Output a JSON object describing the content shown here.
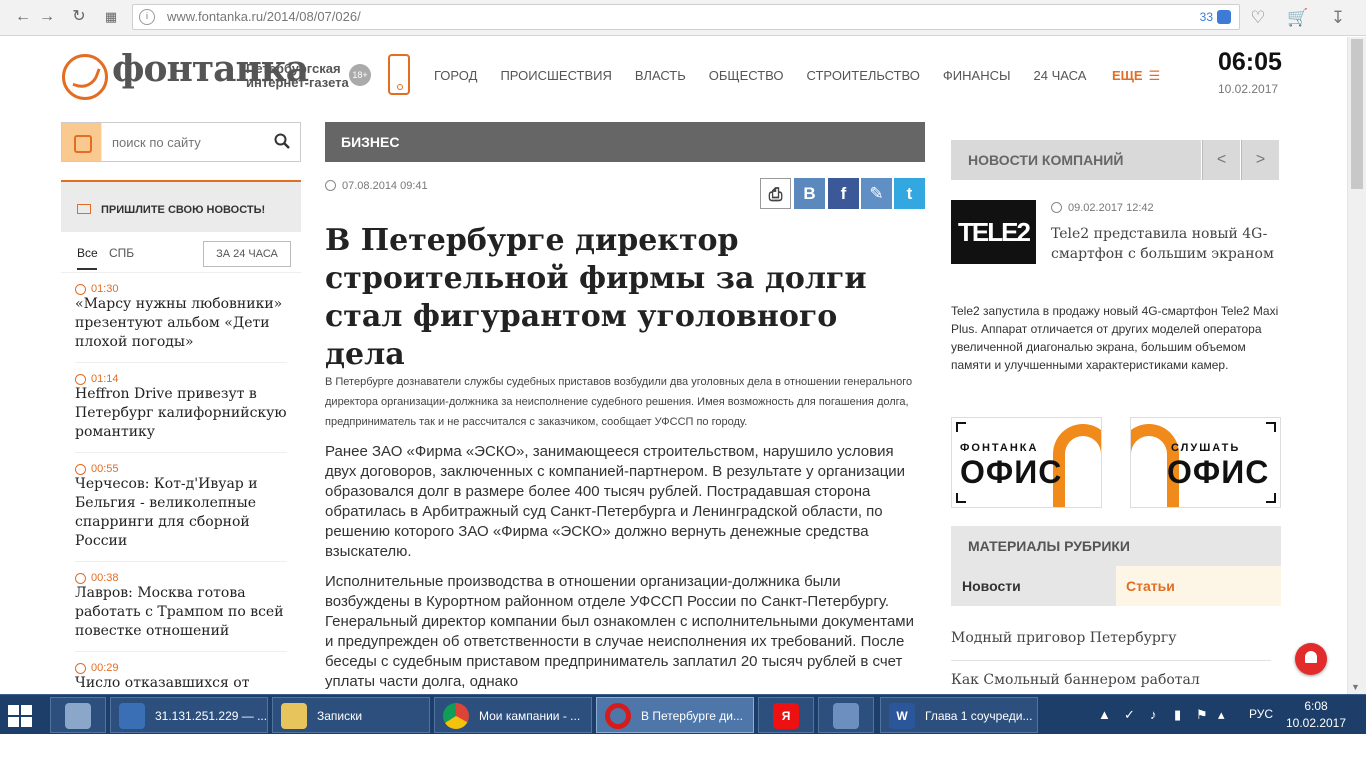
{
  "browser": {
    "url": "www.fontanka.ru/2014/08/07/026/",
    "badge_count": "33"
  },
  "site": {
    "logo": "фонтанка",
    "tagline_1": "Петербургская",
    "tagline_2": "интернет-газета",
    "age": "18+",
    "nav": [
      "ГОРОД",
      "ПРОИСШЕСТВИЯ",
      "ВЛАСТЬ",
      "ОБЩЕСТВО",
      "СТРОИТЕЛЬСТВО",
      "ФИНАНСЫ",
      "24 ЧАСА"
    ],
    "more": "ЕЩЕ",
    "time": "06:05",
    "date": "10.02.2017",
    "accent_color": "#e26d23"
  },
  "left": {
    "search_placeholder": "поиск по сайту",
    "send_news": "ПРИШЛИТЕ СВОЮ НОВОСТЬ!",
    "tab_all": "Все",
    "tab_spb": "СПБ",
    "tab_24": "ЗА 24 ЧАСА",
    "feed": [
      {
        "time": "01:30",
        "title": "«Марсу нужны любовники» презентуют альбом «Дети плохой погоды»"
      },
      {
        "time": "01:14",
        "title": "Heffron Drive привезут в Петербург калифорнийскую романтику"
      },
      {
        "time": "00:55",
        "title": "Черчесов: Кот-д'Ивуар и Бельгия - великолепные спарринги для сборной России"
      },
      {
        "time": "00:38",
        "title": "Лавров: Москва готова работать с Трампом по всей повестке отношений"
      },
      {
        "time": "00:29",
        "title": "Число отказавшихся от"
      }
    ]
  },
  "article": {
    "section": "БИЗНЕС",
    "date": "07.08.2014 09:41",
    "title": "В Петербурге директор строительной фирмы за долги стал фигурантом уголовного дела",
    "lead": "В Петербурге дознаватели службы судебных приставов возбудили два уголовных дела в отношении генерального директора организации-должника за неисполнение судебного решения. Имея возможность для погашения долга, предприниматель так и не рассчитался с заказчиком, сообщает УФССП по городу.",
    "para1": "Ранее ЗАО «Фирма «ЭСКО», занимающееся строительством, нарушило условия двух договоров, заключенных с компанией-партнером. В результате у организации образовался долг в размере более 400 тысяч рублей. Пострадавшая сторона обратилась в Арбитражный суд Санкт-Петербурга и Ленинградской области, по решению которого ЗАО «Фирма «ЭСКО» должно вернуть денежные средства взыскателю.",
    "para2": "Исполнительные производства в отношении организации-должника были возбуждены в Курортном районном отделе УФССП России по Санкт-Петербургу. Генеральный директор компании был ознакомлен с исполнительными документами и предупрежден об ответственности в случае неисполнения их требований. После беседы с судебным приставом предприниматель заплатил 20 тысяч рублей в счет уплаты части долга, однако",
    "share": [
      "print",
      "vk",
      "facebook",
      "lj",
      "twitter"
    ]
  },
  "right": {
    "company_news": "НОВОСТИ КОМПАНИЙ",
    "prev": "<",
    "next": ">",
    "tele2_logo": "TELE2",
    "news_date": "09.02.2017 12:42",
    "news_title": "Tele2 представила новый 4G-смартфон с большим экраном",
    "news_text": "Tele2 запустила в продажу новый 4G-смартфон Tele2 Maxi Plus. Аппарат отличается от других моделей оператора увеличенной диагональю экрана, большим объемом памяти и улучшенными характеристиками камер.",
    "banner1_top": "ФОНТАНКА",
    "banner1_main": "ОФИС",
    "banner2_top": "СЛУШАТЬ",
    "banner2_main": "ОФИС",
    "rubric_title": "МАТЕРИАЛЫ РУБРИКИ",
    "rubric_tab1": "Новости",
    "rubric_tab2": "Статьи",
    "links": [
      "Модный приговор Петербургу",
      "Как Смольный баннером работал"
    ]
  },
  "taskbar": {
    "tasks": [
      {
        "label": "",
        "icon": "calculator-icon"
      },
      {
        "label": "31.131.251.229 — ...",
        "icon": "remote-desktop-icon"
      },
      {
        "label": "Записки",
        "icon": "folder-icon"
      },
      {
        "label": "Мои кампании - ...",
        "icon": "chrome-icon"
      },
      {
        "label": "В Петербурге ди...",
        "icon": "opera-icon"
      },
      {
        "label": "",
        "icon": "yandex-icon"
      },
      {
        "label": "",
        "icon": "speaker-icon"
      },
      {
        "label": "Глава 1 соучреди...",
        "icon": "word-icon"
      }
    ],
    "lang": "РУС",
    "time": "6:08",
    "date": "10.02.2017"
  }
}
